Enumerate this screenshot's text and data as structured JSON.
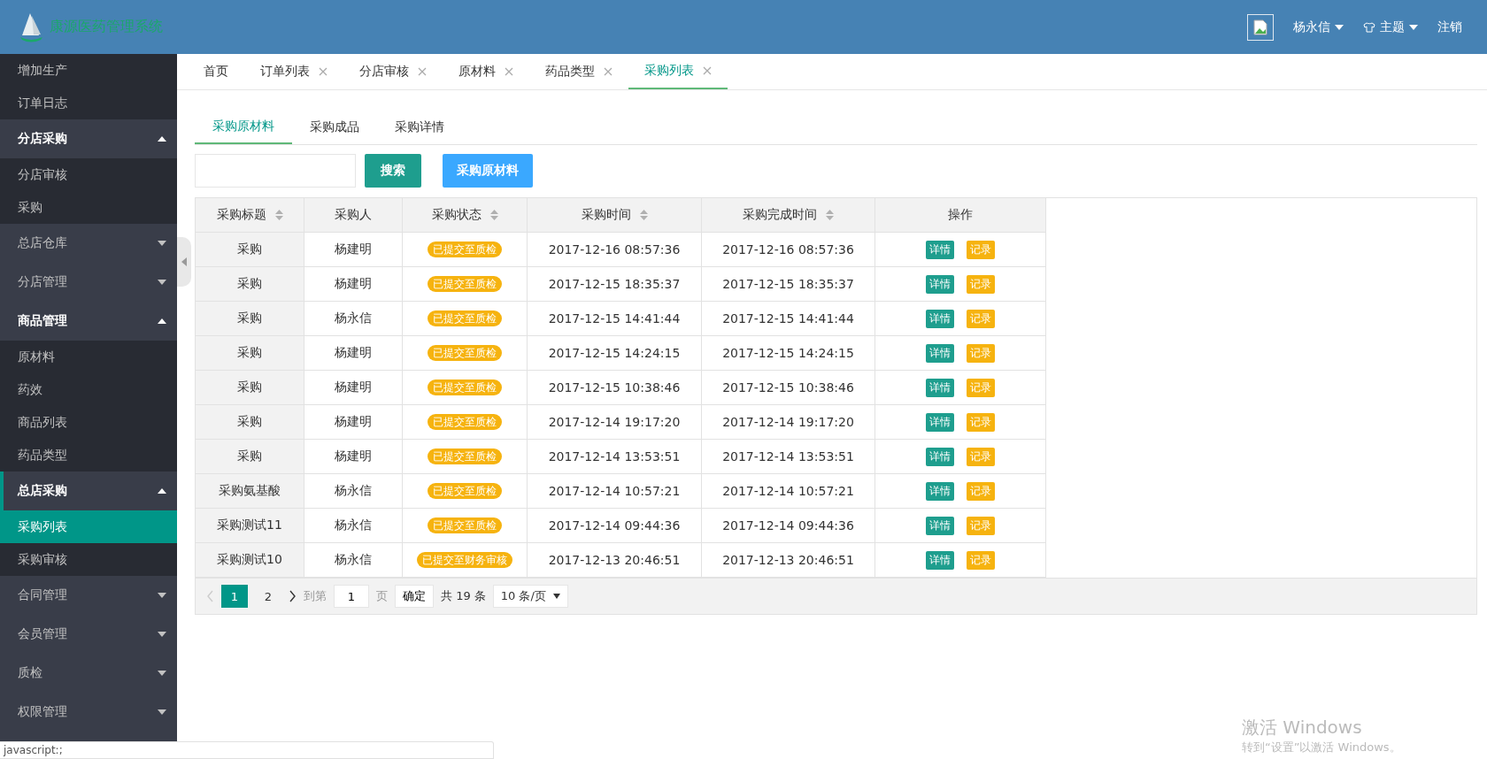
{
  "header": {
    "title": "康源医药管理系统",
    "user_name": "杨永信",
    "theme_menu": "主题",
    "logout": "注销"
  },
  "sidebar": {
    "items": [
      {
        "kind": "link",
        "label": "增加生产",
        "selected": false
      },
      {
        "kind": "link",
        "label": "订单日志",
        "selected": false
      },
      {
        "kind": "group",
        "label": "分店采购",
        "expanded": true,
        "children": [
          {
            "label": "分店审核",
            "selected": false
          },
          {
            "label": "采购",
            "selected": false
          }
        ]
      },
      {
        "kind": "group",
        "label": "总店仓库",
        "expanded": false
      },
      {
        "kind": "group",
        "label": "分店管理",
        "expanded": false
      },
      {
        "kind": "group",
        "label": "商品管理",
        "expanded": true,
        "children": [
          {
            "label": "原材料",
            "selected": false
          },
          {
            "label": "药效",
            "selected": false
          },
          {
            "label": "商品列表",
            "selected": false
          },
          {
            "label": "药品类型",
            "selected": false
          }
        ]
      },
      {
        "kind": "group",
        "label": "总店采购",
        "expanded": true,
        "children": [
          {
            "label": "采购列表",
            "selected": true
          },
          {
            "label": "采购审核",
            "selected": false
          }
        ]
      },
      {
        "kind": "group",
        "label": "合同管理",
        "expanded": false
      },
      {
        "kind": "group",
        "label": "会员管理",
        "expanded": false
      },
      {
        "kind": "group",
        "label": "质检",
        "expanded": false
      },
      {
        "kind": "group",
        "label": "权限管理",
        "expanded": false
      }
    ]
  },
  "tabs": [
    {
      "label": "首页",
      "closable": false,
      "selected": false
    },
    {
      "label": "订单列表",
      "closable": true,
      "selected": false
    },
    {
      "label": "分店审核",
      "closable": true,
      "selected": false
    },
    {
      "label": "原材料",
      "closable": true,
      "selected": false
    },
    {
      "label": "药品类型",
      "closable": true,
      "selected": false
    },
    {
      "label": "采购列表",
      "closable": true,
      "selected": true
    }
  ],
  "subtabs": [
    {
      "label": "采购原材料",
      "selected": true
    },
    {
      "label": "采购成品",
      "selected": false
    },
    {
      "label": "采购详情",
      "selected": false
    }
  ],
  "toolbar": {
    "search_button": "搜索",
    "add_button": "采购原材料"
  },
  "table": {
    "columns": [
      {
        "label": "采购标题",
        "sortable": true
      },
      {
        "label": "采购人",
        "sortable": false
      },
      {
        "label": "采购状态",
        "sortable": true
      },
      {
        "label": "采购时间",
        "sortable": true
      },
      {
        "label": "采购完成时间",
        "sortable": true
      },
      {
        "label": "操作",
        "sortable": false
      }
    ],
    "rows": [
      {
        "title": "采购",
        "buyer": "杨建明",
        "status": "已提交至质检",
        "created": "2017-12-16 08:57:36",
        "finished": "2017-12-16 08:57:36",
        "actions": [
          "详情",
          "记录"
        ]
      },
      {
        "title": "采购",
        "buyer": "杨建明",
        "status": "已提交至质检",
        "created": "2017-12-15 18:35:37",
        "finished": "2017-12-15 18:35:37",
        "actions": [
          "详情",
          "记录"
        ]
      },
      {
        "title": "采购",
        "buyer": "杨永信",
        "status": "已提交至质检",
        "created": "2017-12-15 14:41:44",
        "finished": "2017-12-15 14:41:44",
        "actions": [
          "详情",
          "记录"
        ]
      },
      {
        "title": "采购",
        "buyer": "杨建明",
        "status": "已提交至质检",
        "created": "2017-12-15 14:24:15",
        "finished": "2017-12-15 14:24:15",
        "actions": [
          "详情",
          "记录"
        ]
      },
      {
        "title": "采购",
        "buyer": "杨建明",
        "status": "已提交至质检",
        "created": "2017-12-15 10:38:46",
        "finished": "2017-12-15 10:38:46",
        "actions": [
          "详情",
          "记录"
        ]
      },
      {
        "title": "采购",
        "buyer": "杨建明",
        "status": "已提交至质检",
        "created": "2017-12-14 19:17:20",
        "finished": "2017-12-14 19:17:20",
        "actions": [
          "详情",
          "记录"
        ]
      },
      {
        "title": "采购",
        "buyer": "杨建明",
        "status": "已提交至质检",
        "created": "2017-12-14 13:53:51",
        "finished": "2017-12-14 13:53:51",
        "actions": [
          "详情",
          "记录"
        ]
      },
      {
        "title": "采购氨基酸",
        "buyer": "杨永信",
        "status": "已提交至质检",
        "created": "2017-12-14 10:57:21",
        "finished": "2017-12-14 10:57:21",
        "actions": [
          "详情",
          "记录"
        ]
      },
      {
        "title": "采购测试11",
        "buyer": "杨永信",
        "status": "已提交至质检",
        "created": "2017-12-14 09:44:36",
        "finished": "2017-12-14 09:44:36",
        "actions": [
          "详情",
          "记录"
        ]
      },
      {
        "title": "采购测试10",
        "buyer": "杨永信",
        "status": "已提交至财务审核",
        "created": "2017-12-13 20:46:51",
        "finished": "2017-12-13 20:46:51",
        "actions": [
          "详情",
          "记录"
        ]
      }
    ]
  },
  "pagination": {
    "prev_disabled": true,
    "pages": [
      {
        "label": "1",
        "selected": true
      },
      {
        "label": "2",
        "selected": false
      }
    ],
    "goto_label": "到第",
    "page_input": "1",
    "page_unit": "页",
    "confirm": "确定",
    "total": "共 19 条",
    "page_size": "10 条/页"
  },
  "status_bar": "javascript:;",
  "windows_activation": {
    "title": "激活 Windows",
    "hint": "转到“设置”以激活 Windows。"
  }
}
